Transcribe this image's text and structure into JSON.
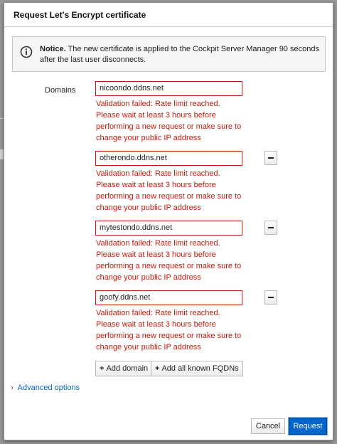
{
  "dialog": {
    "title": "Request Let's Encrypt certificate"
  },
  "notice": {
    "icon": "info-circle-icon",
    "label": "Notice.",
    "text": " The new certificate is applied to the Cockpit Server Manager 90 seconds after the last user disconnects."
  },
  "domains": {
    "label": "Domains",
    "items": [
      {
        "value": "nicoondo.ddns.net",
        "error": "Validation failed: Rate limit reached. Please wait at least 3 hours before performing a new request or make sure to change your public IP address",
        "removable": false
      },
      {
        "value": "otherondo.ddns.net",
        "error": "Validation failed: Rate limit reached. Please wait at least 3 hours before performing a new request or make sure to change your public IP address",
        "removable": true
      },
      {
        "value": "mytestondo.ddns.net",
        "error": "Validation failed: Rate limit reached. Please wait at least 3 hours before performing a new request or make sure to change your public IP address",
        "removable": true
      },
      {
        "value": "goofy.ddns.net",
        "error": "Validation failed: Rate limit reached. Please wait at least 3 hours before performing a new request or make sure to change your public IP address",
        "removable": true
      }
    ],
    "add_domain_label": "Add domain",
    "add_fqdns_label": "Add all known FQDNs"
  },
  "advanced": {
    "label": "Advanced options"
  },
  "footer": {
    "cancel_label": "Cancel",
    "request_label": "Request"
  },
  "colors": {
    "error": "#c9190b",
    "primary": "#0066cc",
    "link": "#0066cc"
  }
}
